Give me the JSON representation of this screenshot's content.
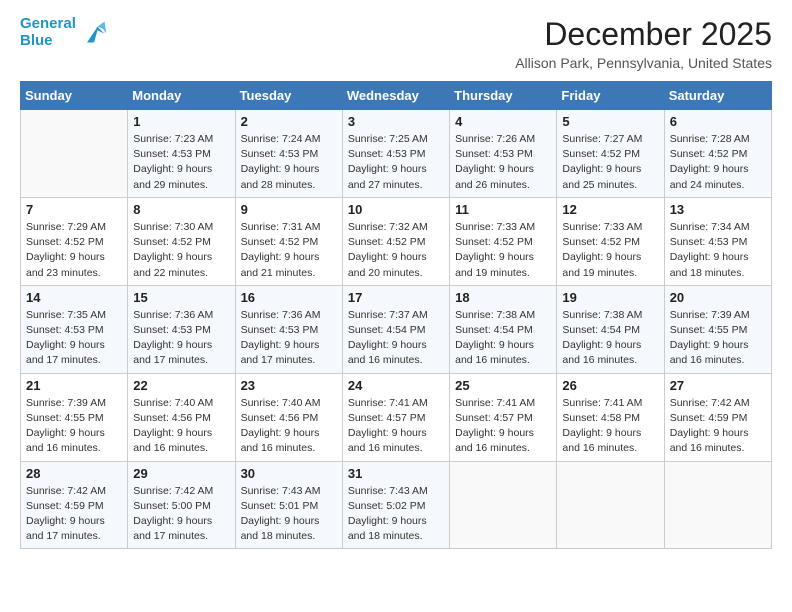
{
  "header": {
    "logo_line1": "General",
    "logo_line2": "Blue",
    "title": "December 2025",
    "subtitle": "Allison Park, Pennsylvania, United States"
  },
  "weekdays": [
    "Sunday",
    "Monday",
    "Tuesday",
    "Wednesday",
    "Thursday",
    "Friday",
    "Saturday"
  ],
  "weeks": [
    [
      {
        "day": "",
        "sunrise": "",
        "sunset": "",
        "daylight": ""
      },
      {
        "day": "1",
        "sunrise": "7:23 AM",
        "sunset": "4:53 PM",
        "daylight": "9 hours and 29 minutes."
      },
      {
        "day": "2",
        "sunrise": "7:24 AM",
        "sunset": "4:53 PM",
        "daylight": "9 hours and 28 minutes."
      },
      {
        "day": "3",
        "sunrise": "7:25 AM",
        "sunset": "4:53 PM",
        "daylight": "9 hours and 27 minutes."
      },
      {
        "day": "4",
        "sunrise": "7:26 AM",
        "sunset": "4:53 PM",
        "daylight": "9 hours and 26 minutes."
      },
      {
        "day": "5",
        "sunrise": "7:27 AM",
        "sunset": "4:52 PM",
        "daylight": "9 hours and 25 minutes."
      },
      {
        "day": "6",
        "sunrise": "7:28 AM",
        "sunset": "4:52 PM",
        "daylight": "9 hours and 24 minutes."
      }
    ],
    [
      {
        "day": "7",
        "sunrise": "7:29 AM",
        "sunset": "4:52 PM",
        "daylight": "9 hours and 23 minutes."
      },
      {
        "day": "8",
        "sunrise": "7:30 AM",
        "sunset": "4:52 PM",
        "daylight": "9 hours and 22 minutes."
      },
      {
        "day": "9",
        "sunrise": "7:31 AM",
        "sunset": "4:52 PM",
        "daylight": "9 hours and 21 minutes."
      },
      {
        "day": "10",
        "sunrise": "7:32 AM",
        "sunset": "4:52 PM",
        "daylight": "9 hours and 20 minutes."
      },
      {
        "day": "11",
        "sunrise": "7:33 AM",
        "sunset": "4:52 PM",
        "daylight": "9 hours and 19 minutes."
      },
      {
        "day": "12",
        "sunrise": "7:33 AM",
        "sunset": "4:52 PM",
        "daylight": "9 hours and 19 minutes."
      },
      {
        "day": "13",
        "sunrise": "7:34 AM",
        "sunset": "4:53 PM",
        "daylight": "9 hours and 18 minutes."
      }
    ],
    [
      {
        "day": "14",
        "sunrise": "7:35 AM",
        "sunset": "4:53 PM",
        "daylight": "9 hours and 17 minutes."
      },
      {
        "day": "15",
        "sunrise": "7:36 AM",
        "sunset": "4:53 PM",
        "daylight": "9 hours and 17 minutes."
      },
      {
        "day": "16",
        "sunrise": "7:36 AM",
        "sunset": "4:53 PM",
        "daylight": "9 hours and 17 minutes."
      },
      {
        "day": "17",
        "sunrise": "7:37 AM",
        "sunset": "4:54 PM",
        "daylight": "9 hours and 16 minutes."
      },
      {
        "day": "18",
        "sunrise": "7:38 AM",
        "sunset": "4:54 PM",
        "daylight": "9 hours and 16 minutes."
      },
      {
        "day": "19",
        "sunrise": "7:38 AM",
        "sunset": "4:54 PM",
        "daylight": "9 hours and 16 minutes."
      },
      {
        "day": "20",
        "sunrise": "7:39 AM",
        "sunset": "4:55 PM",
        "daylight": "9 hours and 16 minutes."
      }
    ],
    [
      {
        "day": "21",
        "sunrise": "7:39 AM",
        "sunset": "4:55 PM",
        "daylight": "9 hours and 16 minutes."
      },
      {
        "day": "22",
        "sunrise": "7:40 AM",
        "sunset": "4:56 PM",
        "daylight": "9 hours and 16 minutes."
      },
      {
        "day": "23",
        "sunrise": "7:40 AM",
        "sunset": "4:56 PM",
        "daylight": "9 hours and 16 minutes."
      },
      {
        "day": "24",
        "sunrise": "7:41 AM",
        "sunset": "4:57 PM",
        "daylight": "9 hours and 16 minutes."
      },
      {
        "day": "25",
        "sunrise": "7:41 AM",
        "sunset": "4:57 PM",
        "daylight": "9 hours and 16 minutes."
      },
      {
        "day": "26",
        "sunrise": "7:41 AM",
        "sunset": "4:58 PM",
        "daylight": "9 hours and 16 minutes."
      },
      {
        "day": "27",
        "sunrise": "7:42 AM",
        "sunset": "4:59 PM",
        "daylight": "9 hours and 16 minutes."
      }
    ],
    [
      {
        "day": "28",
        "sunrise": "7:42 AM",
        "sunset": "4:59 PM",
        "daylight": "9 hours and 17 minutes."
      },
      {
        "day": "29",
        "sunrise": "7:42 AM",
        "sunset": "5:00 PM",
        "daylight": "9 hours and 17 minutes."
      },
      {
        "day": "30",
        "sunrise": "7:43 AM",
        "sunset": "5:01 PM",
        "daylight": "9 hours and 18 minutes."
      },
      {
        "day": "31",
        "sunrise": "7:43 AM",
        "sunset": "5:02 PM",
        "daylight": "9 hours and 18 minutes."
      },
      {
        "day": "",
        "sunrise": "",
        "sunset": "",
        "daylight": ""
      },
      {
        "day": "",
        "sunrise": "",
        "sunset": "",
        "daylight": ""
      },
      {
        "day": "",
        "sunrise": "",
        "sunset": "",
        "daylight": ""
      }
    ]
  ],
  "labels": {
    "sunrise_prefix": "Sunrise: ",
    "sunset_prefix": "Sunset: ",
    "daylight_prefix": "Daylight: "
  }
}
